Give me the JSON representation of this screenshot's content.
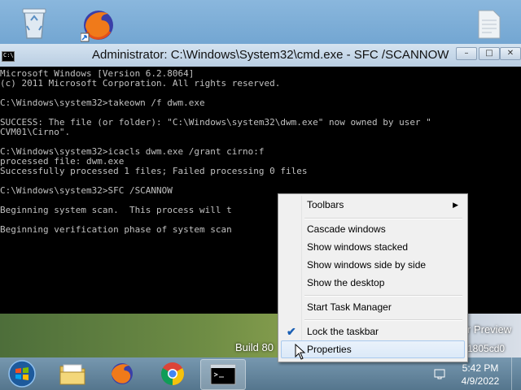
{
  "desktop": {
    "icons": [
      "recycle-bin-icon",
      "firefox-icon",
      "document-icon"
    ],
    "watermark": {
      "build": "Build 80",
      "preview": "r Preview",
      "hash": "1805cd0"
    }
  },
  "cmd_window": {
    "title": "Administrator: C:\\Windows\\System32\\cmd.exe - SFC  /SCANNOW",
    "icon_text": "C:\\",
    "lines": [
      "Microsoft Windows [Version 6.2.8064]",
      "(c) 2011 Microsoft Corporation. All rights reserved.",
      "",
      "C:\\Windows\\system32>takeown /f dwm.exe",
      "",
      "SUCCESS: The file (or folder): \"C:\\Windows\\system32\\dwm.exe\" now owned by user \"",
      "CVM01\\Cirno\".",
      "",
      "C:\\Windows\\system32>icacls dwm.exe /grant cirno:f",
      "processed file: dwm.exe",
      "Successfully processed 1 files; Failed processing 0 files",
      "",
      "C:\\Windows\\system32>SFC /SCANNOW",
      "",
      "Beginning system scan.  This process will t",
      "",
      "Beginning verification phase of system scan"
    ],
    "buttons": {
      "minimize": "–",
      "maximize": "□",
      "close": "✕"
    }
  },
  "context_menu": {
    "items": {
      "toolbars": "Toolbars",
      "cascade": "Cascade windows",
      "stacked": "Show windows stacked",
      "side_by_side": "Show windows side by side",
      "show_desktop": "Show the desktop",
      "task_manager": "Start Task Manager",
      "lock_taskbar": "Lock the taskbar",
      "properties": "Properties"
    },
    "lock_checked": true
  },
  "taskbar": {
    "pinned": [
      "start-orb-icon",
      "explorer-icon",
      "firefox-icon",
      "chrome-icon",
      "cmd-icon"
    ],
    "clock": {
      "time": "5:42 PM",
      "date": "4/9/2022"
    }
  },
  "colors": {
    "console_bg": "#000000",
    "console_fg": "#c0c0c0",
    "menu_bg": "#f0f0f0",
    "check": "#1a5fb4"
  }
}
